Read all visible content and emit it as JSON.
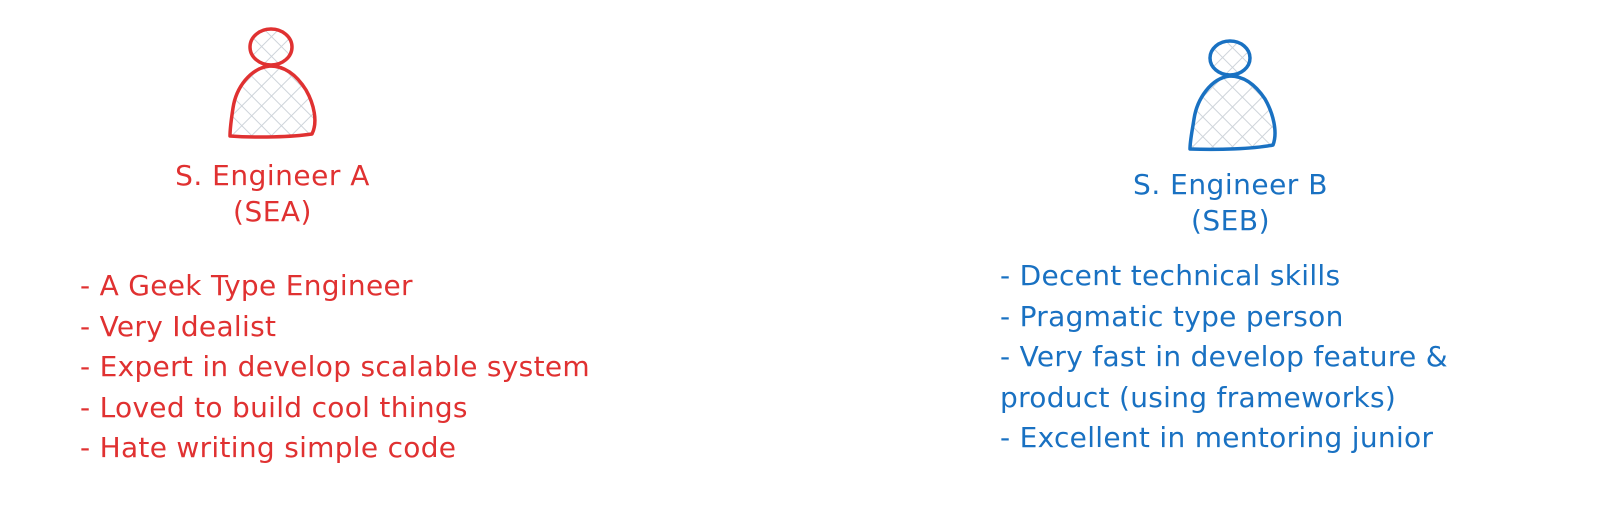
{
  "colors": {
    "engineer_a": "#e03131",
    "engineer_b": "#1971c2",
    "hatch": "#ced4da",
    "background": "#ffffff"
  },
  "personas": [
    {
      "id": "sea",
      "icon": "person-icon",
      "title_line1": "S. Engineer A",
      "title_line2": "(SEA)",
      "traits": [
        "- A Geek Type Engineer",
        "- Very Idealist",
        "- Expert in develop scalable system",
        "- Loved to build cool things",
        "- Hate writing simple code"
      ]
    },
    {
      "id": "seb",
      "icon": "person-icon",
      "title_line1": "S. Engineer B",
      "title_line2": "(SEB)",
      "traits": [
        "- Decent technical skills",
        "- Pragmatic type person",
        "- Very fast in develop feature &",
        "product (using frameworks)",
        "- Excellent in mentoring junior"
      ]
    }
  ]
}
